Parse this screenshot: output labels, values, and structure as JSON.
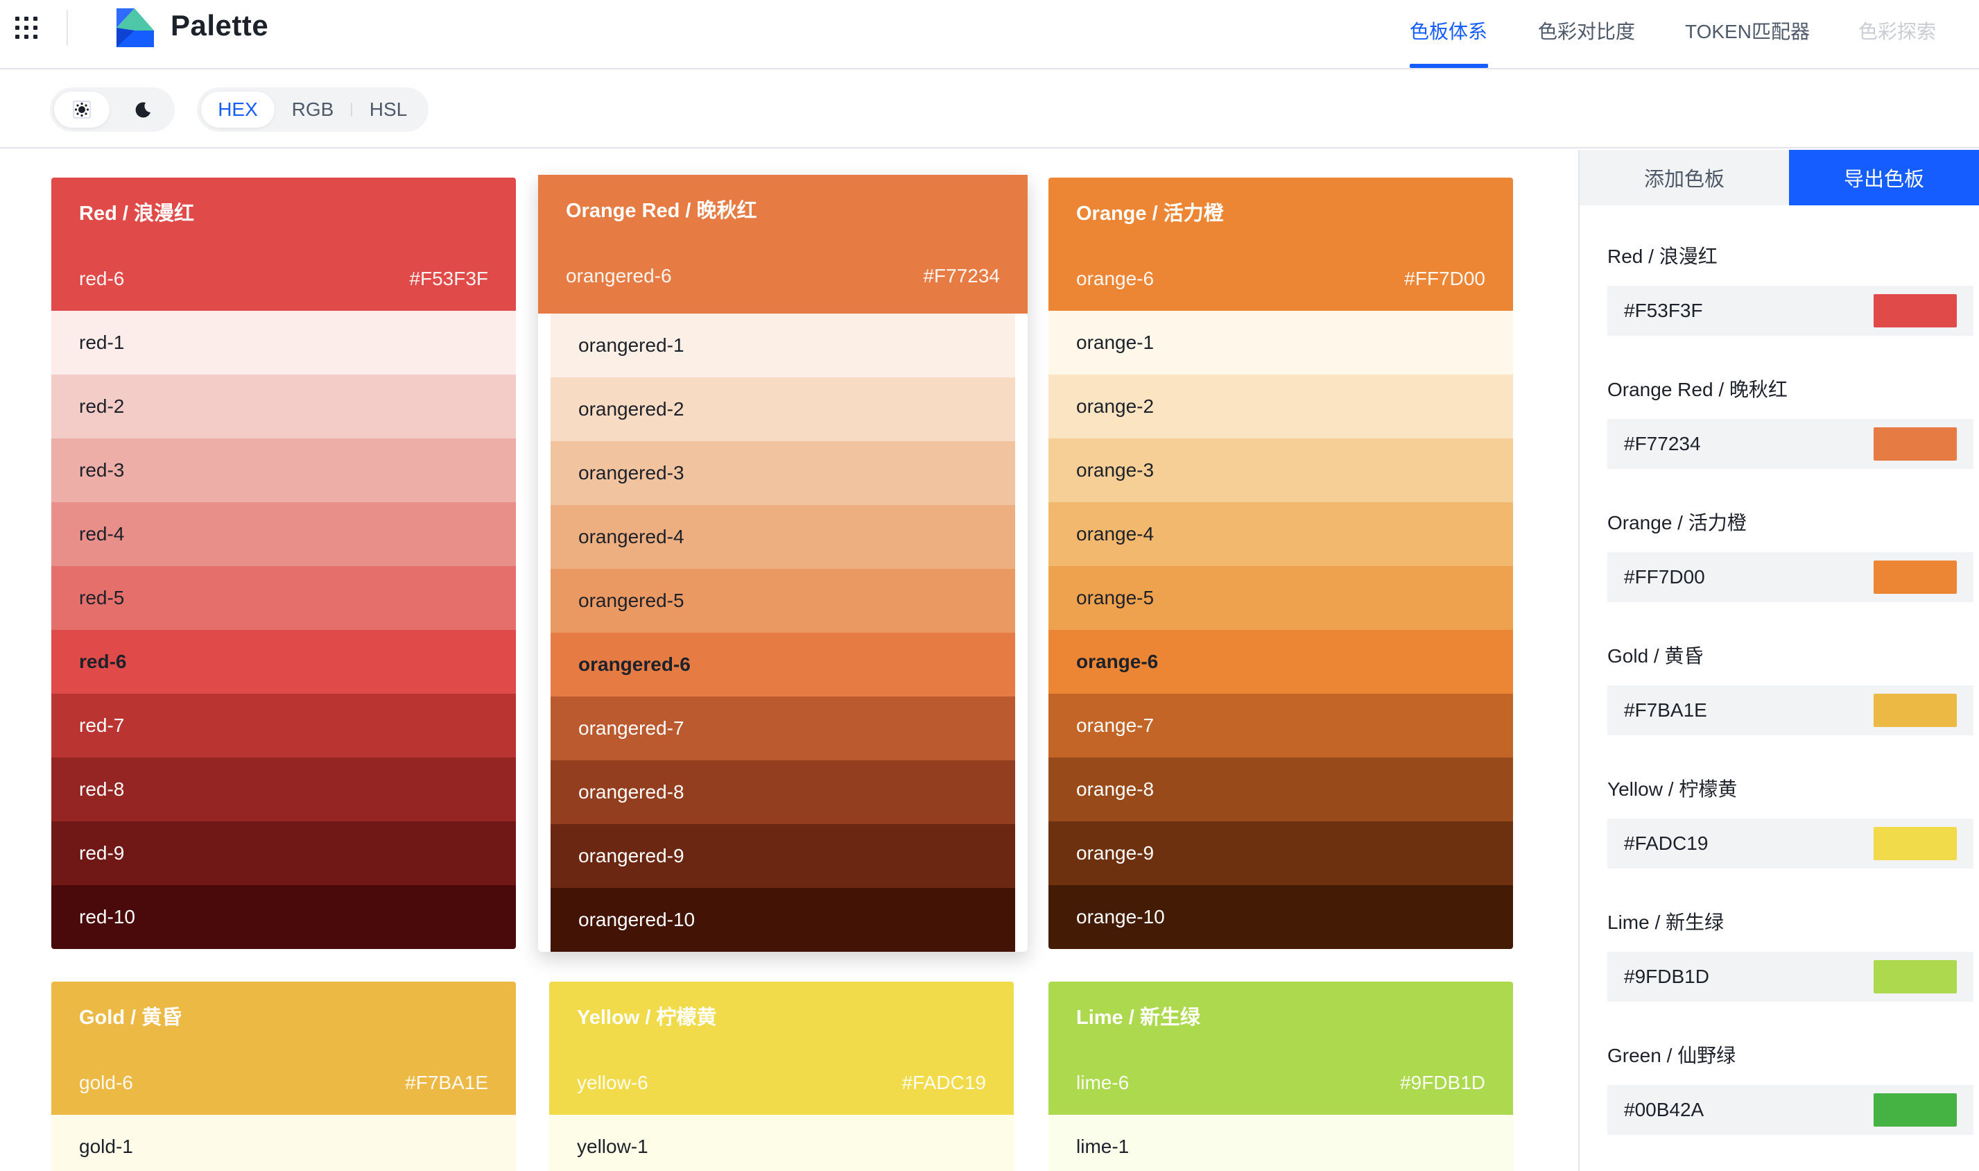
{
  "app": {
    "name": "Palette"
  },
  "nav": [
    {
      "label": "色板体系",
      "state": "active"
    },
    {
      "label": "色彩对比度",
      "state": "normal"
    },
    {
      "label": "TOKEN匹配器",
      "state": "normal"
    },
    {
      "label": "色彩探索",
      "state": "disabled"
    }
  ],
  "theme_toggle": {
    "options": [
      "light-theme-icon",
      "dark-theme-icon"
    ],
    "selected": "light-theme-icon"
  },
  "format_toggle": {
    "options": [
      "HEX",
      "RGB",
      "HSL"
    ],
    "selected": "HEX"
  },
  "colors": {
    "accent": "#165dff",
    "text": "#1d2129",
    "muted": "#4e5969",
    "disabled": "#c9cdd4"
  },
  "palettes": [
    {
      "title": "Red / 浪漫红",
      "primary_name": "red-6",
      "primary_hex": "#F53F3F",
      "head_color": "#E04B49",
      "raised": false,
      "swatches": [
        {
          "label": "red-1",
          "color": "#FCECEA",
          "text_color": "#1d2129",
          "bold": false
        },
        {
          "label": "red-2",
          "color": "#F4CCC7",
          "text_color": "#1d2129",
          "bold": false
        },
        {
          "label": "red-3",
          "color": "#EDAEA8",
          "text_color": "#1d2129",
          "bold": false
        },
        {
          "label": "red-4",
          "color": "#E88F89",
          "text_color": "#1d2129",
          "bold": false
        },
        {
          "label": "red-5",
          "color": "#E56F6A",
          "text_color": "#1d2129",
          "bold": false
        },
        {
          "label": "red-6",
          "color": "#E04B49",
          "text_color": "#1d2129",
          "bold": true
        },
        {
          "label": "red-7",
          "color": "#BA3432",
          "text_color": "#ffffff",
          "bold": false
        },
        {
          "label": "red-8",
          "color": "#952522",
          "text_color": "#ffffff",
          "bold": false
        },
        {
          "label": "red-9",
          "color": "#6F1816",
          "text_color": "#ffffff",
          "bold": false
        },
        {
          "label": "red-10",
          "color": "#4A0A0B",
          "text_color": "#ffffff",
          "bold": false
        }
      ]
    },
    {
      "title": "Orange Red / 晚秋红",
      "primary_name": "orangered-6",
      "primary_hex": "#F77234",
      "head_color": "#E67B43",
      "raised": true,
      "swatches": [
        {
          "label": "orangered-1",
          "color": "#FCEFE6",
          "text_color": "#1d2129",
          "bold": false
        },
        {
          "label": "orangered-2",
          "color": "#F7DBC2",
          "text_color": "#1d2129",
          "bold": false
        },
        {
          "label": "orangered-3",
          "color": "#F1C39F",
          "text_color": "#1d2129",
          "bold": false
        },
        {
          "label": "orangered-4",
          "color": "#EDAE80",
          "text_color": "#1d2129",
          "bold": false
        },
        {
          "label": "orangered-5",
          "color": "#EA9962",
          "text_color": "#1d2129",
          "bold": false
        },
        {
          "label": "orangered-6",
          "color": "#E67B43",
          "text_color": "#1d2129",
          "bold": true
        },
        {
          "label": "orangered-7",
          "color": "#BB5A2F",
          "text_color": "#ffffff",
          "bold": false
        },
        {
          "label": "orangered-8",
          "color": "#933E1F",
          "text_color": "#ffffff",
          "bold": false
        },
        {
          "label": "orangered-9",
          "color": "#6B2712",
          "text_color": "#ffffff",
          "bold": false
        },
        {
          "label": "orangered-10",
          "color": "#431406",
          "text_color": "#ffffff",
          "bold": false
        }
      ]
    },
    {
      "title": "Orange / 活力橙",
      "primary_name": "orange-6",
      "primary_hex": "#FF7D00",
      "head_color": "#EC8635",
      "raised": false,
      "swatches": [
        {
          "label": "orange-1",
          "color": "#FEF7EA",
          "text_color": "#1d2129",
          "bold": false
        },
        {
          "label": "orange-2",
          "color": "#FAE4C2",
          "text_color": "#1d2129",
          "bold": false
        },
        {
          "label": "orange-3",
          "color": "#F6CF96",
          "text_color": "#1d2129",
          "bold": false
        },
        {
          "label": "orange-4",
          "color": "#F2B86E",
          "text_color": "#1d2129",
          "bold": false
        },
        {
          "label": "orange-5",
          "color": "#EFA24D",
          "text_color": "#1d2129",
          "bold": false
        },
        {
          "label": "orange-6",
          "color": "#EC8635",
          "text_color": "#1d2129",
          "bold": true
        },
        {
          "label": "orange-7",
          "color": "#C26527",
          "text_color": "#ffffff",
          "bold": false
        },
        {
          "label": "orange-8",
          "color": "#984A1B",
          "text_color": "#ffffff",
          "bold": false
        },
        {
          "label": "orange-9",
          "color": "#6E3110",
          "text_color": "#ffffff",
          "bold": false
        },
        {
          "label": "orange-10",
          "color": "#441C06",
          "text_color": "#ffffff",
          "bold": false
        }
      ]
    },
    {
      "title": "Gold / 黄昏",
      "primary_name": "gold-6",
      "primary_hex": "#F7BA1E",
      "head_color": "#ECB944",
      "raised": false,
      "swatches": [
        {
          "label": "gold-1",
          "color": "#FEFBE8",
          "text_color": "#1d2129",
          "bold": false
        }
      ]
    },
    {
      "title": "Yellow / 柠檬黄",
      "primary_name": "yellow-6",
      "primary_hex": "#FADC19",
      "head_color": "#F2DB4B",
      "raised": false,
      "swatches": [
        {
          "label": "yellow-1",
          "color": "#FEFDE8",
          "text_color": "#1d2129",
          "bold": false
        }
      ]
    },
    {
      "title": "Lime / 新生绿",
      "primary_name": "lime-6",
      "primary_hex": "#9FDB1D",
      "head_color": "#ADD94E",
      "raised": false,
      "swatches": [
        {
          "label": "lime-1",
          "color": "#FBFEEA",
          "text_color": "#1d2129",
          "bold": false
        }
      ]
    }
  ],
  "panel": {
    "tabs": {
      "add": "添加色板",
      "export": "导出色板"
    },
    "items": [
      {
        "name": "Red / 浪漫红",
        "hex": "#F53F3F",
        "chip": "#E04B49"
      },
      {
        "name": "Orange Red / 晚秋红",
        "hex": "#F77234",
        "chip": "#E67B43"
      },
      {
        "name": "Orange / 活力橙",
        "hex": "#FF7D00",
        "chip": "#EC8635"
      },
      {
        "name": "Gold / 黄昏",
        "hex": "#F7BA1E",
        "chip": "#ECB944"
      },
      {
        "name": "Yellow / 柠檬黄",
        "hex": "#FADC19",
        "chip": "#F2DB4B"
      },
      {
        "name": "Lime / 新生绿",
        "hex": "#9FDB1D",
        "chip": "#ADD94E"
      },
      {
        "name": "Green / 仙野绿",
        "hex": "#00B42A",
        "chip": "#45B343"
      }
    ]
  }
}
